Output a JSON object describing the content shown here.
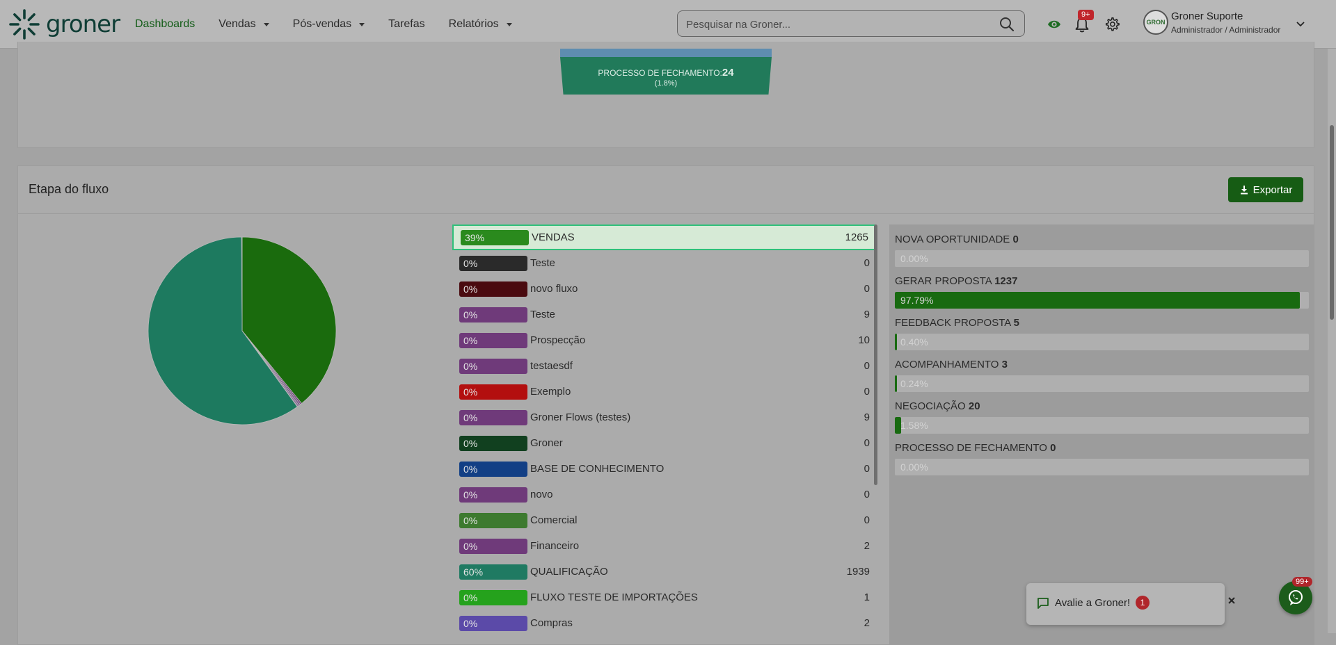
{
  "header": {
    "brand": "groner",
    "nav": [
      {
        "label": "Dashboards",
        "active": true,
        "dropdown": false
      },
      {
        "label": "Vendas",
        "active": false,
        "dropdown": true
      },
      {
        "label": "Pós-vendas",
        "active": false,
        "dropdown": true
      },
      {
        "label": "Tarefas",
        "active": false,
        "dropdown": false
      },
      {
        "label": "Relatórios",
        "active": false,
        "dropdown": true
      }
    ],
    "search_placeholder": "Pesquisar na Groner...",
    "notifications_badge": "9+",
    "user_name": "Groner Suporte",
    "user_role": "Administrador / Administrador",
    "avatar_text": "GRON"
  },
  "funnel": {
    "label": "PROCESSO DE FECHAMENTO:",
    "value": "24",
    "percent": "(1.8%)"
  },
  "etapa": {
    "title": "Etapa do fluxo",
    "export_label": "Exportar"
  },
  "flows": [
    {
      "pct": "39%",
      "name": "VENDAS",
      "count": "1265",
      "color": "#2a8a1d",
      "selected": true
    },
    {
      "pct": "0%",
      "name": "Teste",
      "count": "0",
      "color": "#2a2a2a"
    },
    {
      "pct": "0%",
      "name": "novo fluxo",
      "count": "0",
      "color": "#4a0a0f"
    },
    {
      "pct": "0%",
      "name": "Teste",
      "count": "9",
      "color": "#6f3a7a"
    },
    {
      "pct": "0%",
      "name": "Prospecção",
      "count": "10",
      "color": "#6f3a7a"
    },
    {
      "pct": "0%",
      "name": "testaesdf",
      "count": "0",
      "color": "#6f3a7a"
    },
    {
      "pct": "0%",
      "name": "Exemplo",
      "count": "0",
      "color": "#b30f0f"
    },
    {
      "pct": "0%",
      "name": "Groner Flows (testes)",
      "count": "9",
      "color": "#6f3a7a"
    },
    {
      "pct": "0%",
      "name": "Groner",
      "count": "0",
      "color": "#11401f"
    },
    {
      "pct": "0%",
      "name": "BASE DE CONHECIMENTO",
      "count": "0",
      "color": "#123f85"
    },
    {
      "pct": "0%",
      "name": "novo",
      "count": "0",
      "color": "#6f3a7a"
    },
    {
      "pct": "0%",
      "name": "Comercial",
      "count": "0",
      "color": "#3d7a2f"
    },
    {
      "pct": "0%",
      "name": "Financeiro",
      "count": "2",
      "color": "#6f3a7a"
    },
    {
      "pct": "60%",
      "name": "QUALIFICAÇÃO",
      "count": "1939",
      "color": "#1f7a62"
    },
    {
      "pct": "0%",
      "name": "FLUXO TESTE DE IMPORTAÇÕES",
      "count": "1",
      "color": "#25a21c"
    },
    {
      "pct": "0%",
      "name": "Compras",
      "count": "2",
      "color": "#5b4aa8"
    }
  ],
  "stages": [
    {
      "name": "NOVA OPORTUNIDADE",
      "count": "0",
      "pct": "0.00%",
      "fraction": 0.0
    },
    {
      "name": "GERAR PROPOSTA",
      "count": "1237",
      "pct": "97.79%",
      "fraction": 0.9779
    },
    {
      "name": "FEEDBACK PROPOSTA",
      "count": "5",
      "pct": "0.40%",
      "fraction": 0.004
    },
    {
      "name": "ACOMPANHAMENTO",
      "count": "3",
      "pct": "0.24%",
      "fraction": 0.0024
    },
    {
      "name": "NEGOCIAÇÃO",
      "count": "20",
      "pct": "1.58%",
      "fraction": 0.0158
    },
    {
      "name": "PROCESSO DE FECHAMENTO",
      "count": "0",
      "pct": "0.00%",
      "fraction": 0.0
    }
  ],
  "chart_data": {
    "type": "pie",
    "categories": [
      "VENDAS",
      "Teste",
      "novo fluxo",
      "Teste",
      "Prospecção",
      "testaesdf",
      "Exemplo",
      "Groner Flows (testes)",
      "Groner",
      "BASE DE CONHECIMENTO",
      "novo",
      "Comercial",
      "Financeiro",
      "QUALIFICAÇÃO",
      "FLUXO TESTE DE IMPORTAÇÕES",
      "Compras"
    ],
    "values": [
      1265,
      0,
      0,
      9,
      10,
      0,
      0,
      9,
      0,
      0,
      0,
      0,
      2,
      1939,
      1,
      2
    ],
    "colors": [
      "#1a6b0d",
      "#2a2a2a",
      "#4a0a0f",
      "#6f3a7a",
      "#7d5a8a",
      "#6f3a7a",
      "#b30f0f",
      "#8a6a9a",
      "#11401f",
      "#123f85",
      "#6f3a7a",
      "#3d7a2f",
      "#7a5a8a",
      "#1d7a5f",
      "#25a21c",
      "#5b4aa8"
    ]
  },
  "toast": {
    "text": "Avalie a Groner!",
    "badge": "1"
  },
  "whatsapp_badge": "99+"
}
